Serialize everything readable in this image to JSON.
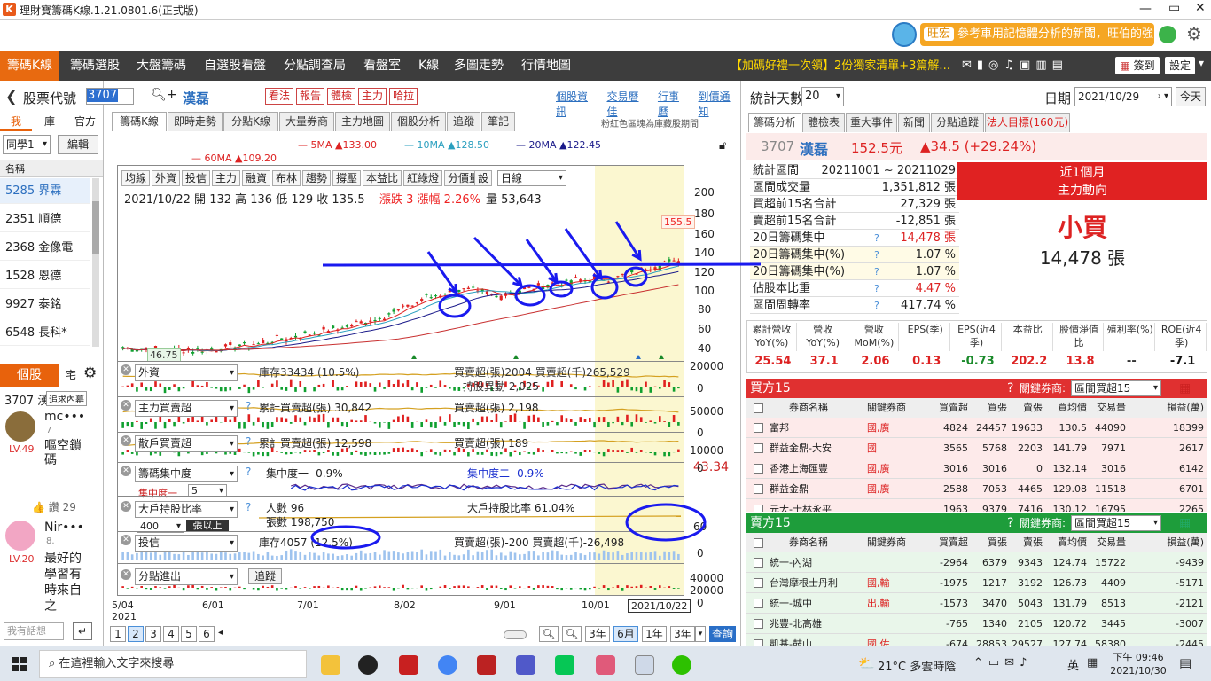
{
  "app": {
    "title": "理財寶籌碼K線.1.21.0801.6(正式版)",
    "ad_badge": "旺宏",
    "ad_text": "參考車用記憶體分析的新聞，旺伯的強"
  },
  "nav": {
    "items": [
      "籌碼K線",
      "籌碼選股",
      "大盤籌碼",
      "自選股看盤",
      "分點調查局",
      "看盤室",
      "K線",
      "多圖走勢",
      "行情地圖"
    ],
    "promo": "【加碼好禮一次領】2份獨家清單+3篇解...",
    "signin": "簽到",
    "settings": "設定"
  },
  "stockbar": {
    "label": "股票代號",
    "code": "3707",
    "name": "漢磊",
    "buttons": [
      "看法",
      "報告",
      "體檢",
      "主力",
      "哈拉"
    ],
    "links": [
      "個股資訊",
      "交易曆佳",
      "行事曆",
      "到價通知"
    ]
  },
  "left": {
    "tabs": [
      "我",
      "庫",
      "官方"
    ],
    "group": "同學1",
    "edit": "編輯",
    "header": "名稱",
    "stocks": [
      "5285 界霖",
      "2351 順德",
      "2368 金像電",
      "1528 恩德",
      "9927 泰銘",
      "6548 長科*"
    ],
    "social_tabs": [
      "個股",
      "宅"
    ],
    "social_code": "3707 漢",
    "social_btn": "追求內幕",
    "posts": [
      {
        "user": "mc•••",
        "num": "7",
        "level": "LV.49",
        "text": "嘔空鎖碼"
      },
      {
        "user": "Nir•••",
        "num": "8.",
        "level": "LV.20",
        "text": "最好的學習有時來自之"
      }
    ],
    "likes": "讚 29",
    "reply_placeholder": "我有話想"
  },
  "center": {
    "tabs": [
      "籌碼K線",
      "即時走勢",
      "分點K線",
      "大量券商",
      "主力地圖",
      "個股分析",
      "追蹤",
      "筆記"
    ],
    "tab_note": "粉紅色區塊為庫藏股期間",
    "ma": [
      "5MA ▲133.00",
      "10MA ▲128.50",
      "20MA ▲122.45",
      "60MA ▲109.20"
    ],
    "toolbar": [
      "均線",
      "外資",
      "投信",
      "主力",
      "融資",
      "布林",
      "趨勢",
      "撐壓",
      "本益比",
      "紅綠燈",
      "分價量",
      "設"
    ],
    "period": "日線",
    "ohlc": "2021/10/22 開 132  高 136  低 129  收 135.5",
    "change": "漲跌 3  漲幅 2.26%",
    "volume": "量 53,643",
    "price_max_label": "155.5",
    "price_min_label": "46.75",
    "panels": [
      {
        "sel": "外資",
        "text": "庫存33434 (10.5%)",
        "text2": "買賣超(張)2004 買賣超(千)265,529",
        "text3": "持股異動 2,025"
      },
      {
        "sel": "主力買賣超",
        "text": "累計買賣超(張) 30,842",
        "text2": "買賣超(張) 2,198"
      },
      {
        "sel": "散戶買賣超",
        "text": "累計買賣超(張) 12,598",
        "text2": "買賣超(張) 189"
      },
      {
        "sel": "籌碼集中度",
        "text": "集中度一 -0.9%",
        "text2": "集中度二 -0.9%",
        "side": "43.34",
        "sub": "集中度一",
        "subval": "5"
      },
      {
        "sel": "大戶持股比率",
        "text": "人數 96",
        "text2": "大戶持股比率 61.04%",
        "text3": "張數 198,750",
        "sub": "400",
        "subunit": "張以上"
      },
      {
        "sel": "投信",
        "text": "庫存4057 (12.5%)",
        "text2": "買賣超(張)-200 買賣超(千)-26,498"
      },
      {
        "sel": "分點進出",
        "text": "追蹤"
      }
    ],
    "xaxis": [
      "5/04",
      "6/01",
      "7/01",
      "8/02",
      "9/01",
      "10/01",
      "2021/10/22"
    ],
    "year": "2021",
    "yticks": [
      "200",
      "180",
      "160",
      "140",
      "120",
      "100",
      "80",
      "60",
      "40"
    ],
    "pages": [
      "1",
      "2",
      "3",
      "4",
      "5",
      "6"
    ],
    "ranges": [
      "3年",
      "6月",
      "1年",
      "3年"
    ],
    "query": "查詢"
  },
  "right": {
    "days_label": "統計天數",
    "days": "20",
    "date_label": "日期",
    "date": "2021/10/29",
    "today": "今天",
    "tabs": [
      "籌碼分析",
      "體檢表",
      "重大事件",
      "新聞",
      "分點追蹤",
      "法人目標(160元)"
    ],
    "stock": "3707 漢磊",
    "price": "152.5元",
    "chg": "▲34.5 (+29.24%)",
    "stats": [
      [
        "統計區間",
        "20211001 ~ 20211029"
      ],
      [
        "區間成交量",
        "1,351,812 張"
      ],
      [
        "買超前15名合計",
        "27,329 張"
      ],
      [
        "賣超前15名合計",
        "-12,851 張"
      ],
      [
        "20日籌碼集中",
        "14,478 張"
      ],
      [
        "20日籌碼集中(%)",
        "1.07 %"
      ],
      [
        "20日籌碼集中(%)",
        "1.07 %"
      ],
      [
        "佔股本比重",
        "4.47 %"
      ],
      [
        "區間周轉率",
        "417.74 %"
      ]
    ],
    "power_title1": "近1個月",
    "power_title2": "主力動向",
    "power_value": "小買",
    "power_amount": "14,478 張",
    "fund_heads": [
      "累計營收YoY(%)",
      "營收YoY(%)",
      "營收MoM(%)",
      "EPS(季)",
      "EPS(近4季)",
      "本益比",
      "股價淨值比",
      "殖利率(%)",
      "ROE(近4季)"
    ],
    "fund_vals": [
      "25.54",
      "37.1",
      "2.06",
      "0.13",
      "-0.73",
      "202.2",
      "13.8",
      "--",
      "-7.1"
    ],
    "buy_title": "買方15",
    "sell_title": "賣方15",
    "filter_label": "關鍵券商:",
    "filter": "區間買超15",
    "cols_buy": [
      "券商名稱",
      "關鍵券商",
      "買賣超",
      "買張",
      "賣張",
      "買均價",
      "交易量",
      "損益(萬)"
    ],
    "cols_sell": [
      "券商名稱",
      "關鍵券商",
      "買賣超",
      "買張",
      "賣張",
      "賣均價",
      "交易量",
      "損益(萬)"
    ],
    "buy_rows": [
      [
        "富邦",
        "國,廣",
        "4824",
        "24457",
        "19633",
        "130.5",
        "44090",
        "18399"
      ],
      [
        "群益金鼎-大安",
        "國",
        "3565",
        "5768",
        "2203",
        "141.79",
        "7971",
        "2617"
      ],
      [
        "香港上海匯豐",
        "國,廣",
        "3016",
        "3016",
        "0",
        "132.14",
        "3016",
        "6142"
      ],
      [
        "群益金鼎",
        "國,廣",
        "2588",
        "7053",
        "4465",
        "129.08",
        "11518",
        "6701"
      ],
      [
        "元大-士林永平",
        "",
        "1963",
        "9379",
        "7416",
        "130.12",
        "16795",
        "2265"
      ]
    ],
    "sell_rows": [
      [
        "統一-內湖",
        "",
        "-2964",
        "6379",
        "9343",
        "124.74",
        "15722",
        "-9439"
      ],
      [
        "台灣摩根士丹利",
        "國,輸",
        "-1975",
        "1217",
        "3192",
        "126.73",
        "4409",
        "-5171"
      ],
      [
        "統一-城中",
        "出,輸",
        "-1573",
        "3470",
        "5043",
        "131.79",
        "8513",
        "-2121"
      ],
      [
        "兆豐-北高雄",
        "",
        "-765",
        "1340",
        "2105",
        "120.72",
        "3445",
        "-3007"
      ],
      [
        "凱基-鼓山",
        "國,佐",
        "-674",
        "28853",
        "29527",
        "127.74",
        "58380",
        "-2445"
      ]
    ]
  },
  "taskbar": {
    "search": "在這裡輸入文字來搜尋",
    "weather": "21°C 多雲時陰",
    "lang": "英",
    "time": "下午 09:46",
    "date": "2021/10/30"
  },
  "chart_data": {
    "type": "candlestick",
    "y_range": [
      40,
      200
    ],
    "x_labels": [
      "5/04",
      "6/01",
      "7/01",
      "8/02",
      "9/01",
      "10/01",
      "2021/10/22"
    ],
    "last_close": 135.5,
    "high_label": 155.5,
    "low_label": 46.75
  }
}
